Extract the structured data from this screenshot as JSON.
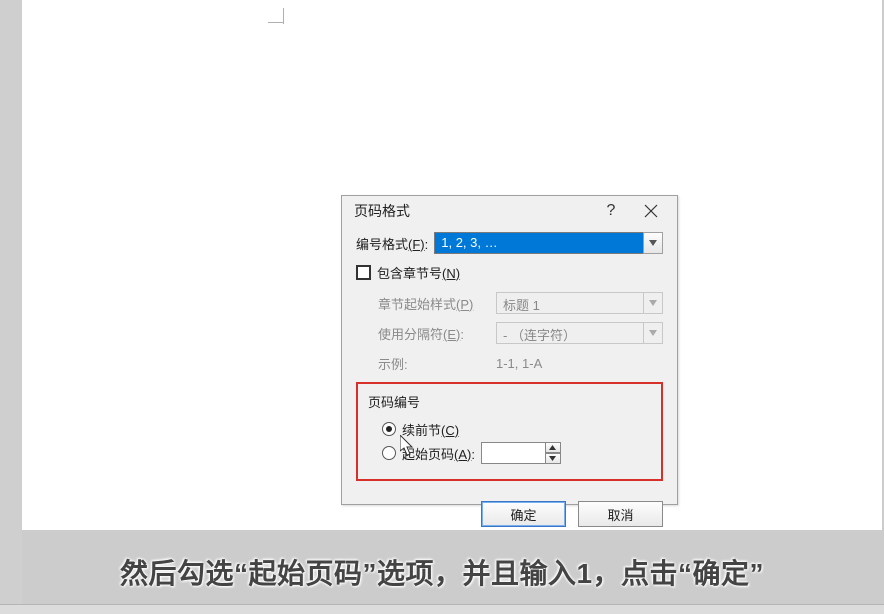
{
  "dialog": {
    "title": "页码格式",
    "help": "?",
    "numFormat": {
      "label": "编号格式",
      "hotkey": "(F)",
      "value": "1, 2, 3, …"
    },
    "includeChapter": {
      "label": "包含章节号",
      "hotkey": "(N)",
      "checked": false
    },
    "chapterStart": {
      "label": "章节起始样式",
      "hotkey": "(P)",
      "value": "标题 1"
    },
    "separator": {
      "label": "使用分隔符",
      "hotkey": "(E)",
      "value": "-  （连字符）"
    },
    "example": {
      "label": "示例:",
      "value": "1-1, 1-A"
    },
    "pageNumberGroup": {
      "title": "页码编号",
      "continue": {
        "label": "续前节",
        "hotkey": "(C)",
        "selected": true
      },
      "startAt": {
        "label": "起始页码",
        "hotkey": "(A)",
        "selected": false,
        "value": ""
      }
    },
    "buttons": {
      "ok": "确定",
      "cancel": "取消"
    }
  },
  "subtitle": "然后勾选“起始页码”选项，并且输入1，点击“确定”"
}
